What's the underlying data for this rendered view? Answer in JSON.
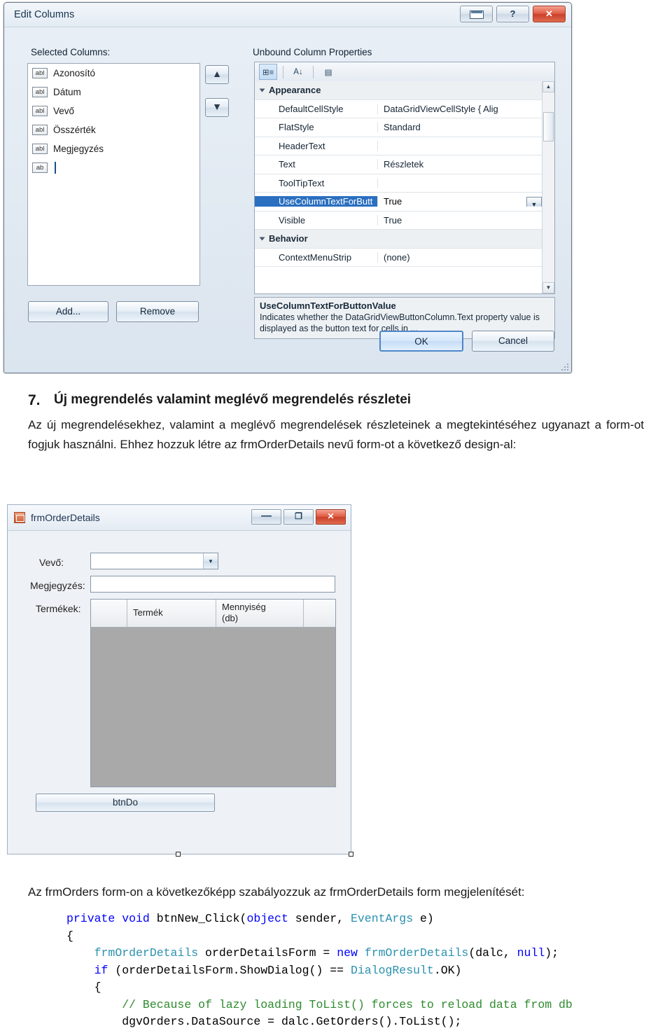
{
  "dialog": {
    "title": "Edit Columns",
    "titlebar_buttons": [
      {
        "name": "restore-button",
        "glyph": ""
      },
      {
        "name": "help-button",
        "glyph": "?"
      },
      {
        "name": "close-button",
        "glyph": "✕"
      }
    ],
    "selected_columns_label": "Selected Columns:",
    "unbound_label": "Unbound Column Properties",
    "columns": [
      {
        "tag": "abl",
        "label": "Azonosító"
      },
      {
        "tag": "abl",
        "label": "Dátum"
      },
      {
        "tag": "abl",
        "label": "Vevő"
      },
      {
        "tag": "abl",
        "label": "Összérték"
      },
      {
        "tag": "abl",
        "label": "Megjegyzés"
      },
      {
        "tag": "ab",
        "label": ""
      }
    ],
    "move_up": "▲",
    "move_down": "▼",
    "add_button": "Add...",
    "remove_button": "Remove",
    "ok_button": "OK",
    "cancel_button": "Cancel",
    "properties": [
      {
        "kind": "category",
        "name": "Appearance"
      },
      {
        "kind": "prop",
        "name": "DefaultCellStyle",
        "value": "DataGridViewCellStyle { Alig"
      },
      {
        "kind": "prop",
        "name": "FlatStyle",
        "value": "Standard"
      },
      {
        "kind": "prop",
        "name": "HeaderText",
        "value": ""
      },
      {
        "kind": "prop",
        "name": "Text",
        "value": "Részletek"
      },
      {
        "kind": "prop",
        "name": "ToolTipText",
        "value": ""
      },
      {
        "kind": "prop",
        "name": "UseColumnTextForButt",
        "value": "True",
        "selected": true,
        "dropdown": true
      },
      {
        "kind": "prop",
        "name": "Visible",
        "value": "True"
      },
      {
        "kind": "category",
        "name": "Behavior"
      },
      {
        "kind": "prop",
        "name": "ContextMenuStrip",
        "value": "(none)"
      }
    ],
    "description_title": "UseColumnTextForButtonValue",
    "description_text": "Indicates whether the DataGridViewButtonColumn.Text property value is displayed as the button text for cells in ..."
  },
  "section": {
    "number": "7.",
    "title": "Új megrendelés valamint meglévő megrendelés részletei",
    "paragraph1": "Az új megrendelésekhez, valamint a meglévő megrendelések részleteinek a megtekintéséhez ugyanazt a form-ot fogjuk használni. Ehhez hozzuk létre az frmOrderDetails nevű form-ot a következő design-al:",
    "paragraph2": "Az frmOrders form-on a következőképp szabályozzuk az frmOrderDetails form megjelenítését:"
  },
  "form_mock": {
    "title": "frmOrderDetails",
    "buttons": {
      "minimize": "—",
      "maximize": "❐",
      "close": "✕"
    },
    "fields": [
      {
        "label": "Vevő:",
        "type": "combobox",
        "value": ""
      },
      {
        "label": "Megjegyzés:",
        "type": "textbox",
        "value": ""
      },
      {
        "label": "Termékek:",
        "type": "datagrid"
      }
    ],
    "grid_headers": [
      "",
      "Termék",
      "Mennyiség\n(db)"
    ],
    "grid_header_1": "Termék",
    "grid_header_2a": "Mennyiség",
    "grid_header_2b": "(db)",
    "action_button": "btnDo"
  },
  "code": {
    "lines": [
      "private void btnNew_Click(object sender, EventArgs e)",
      "{",
      "    frmOrderDetails orderDetailsForm = new frmOrderDetails(dalc, null);",
      "    if (orderDetailsForm.ShowDialog() == DialogResult.OK)",
      "    {",
      "        // Because of lazy loading ToList() forces to reload data from db",
      "        dgvOrders.DataSource = dalc.GetOrders().ToList();"
    ]
  }
}
